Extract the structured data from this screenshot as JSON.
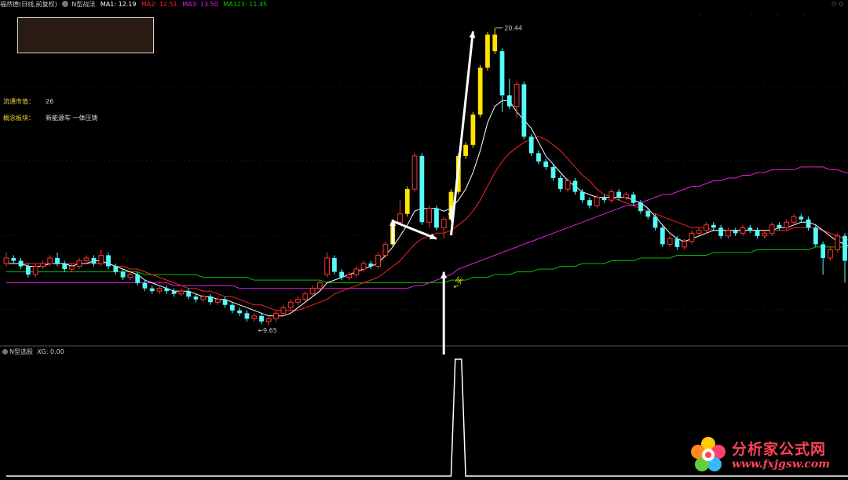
{
  "header": {
    "stock": "福然德(日线,前复权)",
    "indicator": "N型战法",
    "ma1": "MA1: 12.19",
    "ma2": "MA2: 12.51",
    "ma3": "MA3: 13.50",
    "ma123": "MA123: 11.45"
  },
  "colors": {
    "up": "#ff3232",
    "down": "#54fcfc",
    "signal": "#ffe400",
    "ma1": "#ffffff",
    "ma2": "#ff2020",
    "ma3": "#e020e0",
    "ma123": "#00c000"
  },
  "info": {
    "market_cap_label": "流通市值：",
    "market_cap_value": "26",
    "concept_label": "概念板块：",
    "concept_value": "新能源车 一体压铸"
  },
  "annotations": {
    "high": "20.44",
    "low": "9.65",
    "buy": "买"
  },
  "sub": {
    "name": "N型选股",
    "value": "XG: 0.00"
  },
  "watermark": {
    "title": "分析家公式网",
    "url": "www.fxjgsw.com"
  },
  "chart_data": {
    "type": "candlestick",
    "title": "福然德(日线,前复权)",
    "ylim": [
      9.0,
      21.0
    ],
    "candles": [
      [
        11.9,
        12.1,
        12.3,
        11.8
      ],
      [
        12.1,
        12.0,
        12.2,
        11.9
      ],
      [
        12.0,
        11.8,
        12.1,
        11.7
      ],
      [
        11.8,
        11.5,
        11.9,
        11.4
      ],
      [
        11.5,
        11.8,
        11.9,
        11.4
      ],
      [
        11.8,
        11.9,
        12.0,
        11.7
      ],
      [
        11.9,
        12.1,
        12.2,
        11.8
      ],
      [
        12.1,
        11.9,
        12.3,
        11.8
      ],
      [
        11.9,
        11.7,
        12.0,
        11.6
      ],
      [
        11.7,
        11.8,
        11.9,
        11.6
      ],
      [
        11.8,
        12.0,
        12.1,
        11.7
      ],
      [
        12.0,
        12.1,
        12.2,
        11.9
      ],
      [
        12.1,
        11.9,
        12.2,
        11.8
      ],
      [
        11.9,
        12.2,
        12.4,
        11.8
      ],
      [
        12.2,
        11.8,
        12.3,
        11.7
      ],
      [
        11.8,
        11.6,
        11.9,
        11.5
      ],
      [
        11.6,
        11.4,
        11.7,
        11.3
      ],
      [
        11.4,
        11.5,
        11.6,
        11.3
      ],
      [
        11.5,
        11.2,
        11.6,
        11.1
      ],
      [
        11.2,
        11.0,
        11.3,
        10.9
      ],
      [
        11.0,
        10.9,
        11.1,
        10.8
      ],
      [
        10.9,
        11.0,
        11.1,
        10.8
      ],
      [
        11.0,
        10.9,
        11.1,
        10.8
      ],
      [
        10.9,
        10.8,
        11.0,
        10.7
      ],
      [
        10.8,
        10.9,
        11.0,
        10.7
      ],
      [
        10.9,
        10.7,
        11.0,
        10.6
      ],
      [
        10.7,
        10.6,
        10.8,
        10.5
      ],
      [
        10.6,
        10.7,
        10.8,
        10.5
      ],
      [
        10.7,
        10.5,
        10.8,
        10.4
      ],
      [
        10.5,
        10.6,
        10.7,
        10.4
      ],
      [
        10.6,
        10.4,
        10.7,
        10.3
      ],
      [
        10.4,
        10.2,
        10.5,
        10.1
      ],
      [
        10.2,
        10.1,
        10.3,
        10.0
      ],
      [
        10.1,
        9.9,
        10.2,
        9.8
      ],
      [
        9.9,
        10.0,
        10.1,
        9.8
      ],
      [
        10.0,
        9.8,
        10.1,
        9.7
      ],
      [
        9.8,
        9.9,
        10.0,
        9.65
      ],
      [
        9.9,
        10.1,
        10.2,
        9.8
      ],
      [
        10.1,
        10.3,
        10.4,
        10.0
      ],
      [
        10.3,
        10.5,
        10.6,
        10.2
      ],
      [
        10.5,
        10.6,
        10.7,
        10.4
      ],
      [
        10.6,
        10.8,
        10.9,
        10.5
      ],
      [
        10.8,
        11.0,
        11.1,
        10.7
      ],
      [
        11.0,
        11.2,
        11.3,
        10.9
      ],
      [
        11.5,
        12.1,
        12.3,
        11.4
      ],
      [
        12.1,
        11.6,
        12.2,
        11.5
      ],
      [
        11.6,
        11.4,
        11.7,
        11.3
      ],
      [
        11.4,
        11.5,
        11.6,
        11.3
      ],
      [
        11.5,
        11.7,
        11.8,
        11.4
      ],
      [
        11.7,
        11.9,
        12.0,
        11.6
      ],
      [
        11.9,
        11.8,
        12.0,
        11.7
      ],
      [
        11.8,
        12.2,
        12.3,
        11.7
      ],
      [
        12.2,
        12.6,
        12.7,
        12.1
      ],
      [
        12.6,
        13.4,
        13.5,
        12.5
      ],
      [
        13.4,
        13.7,
        14.2,
        13.3
      ],
      [
        13.7,
        14.6,
        14.7,
        13.6
      ],
      [
        14.6,
        15.8,
        15.9,
        14.5
      ],
      [
        15.8,
        13.4,
        15.9,
        13.3
      ],
      [
        13.4,
        13.9,
        14.0,
        13.2
      ],
      [
        13.9,
        13.2,
        14.0,
        13.1
      ],
      [
        13.2,
        13.5,
        13.6,
        12.8
      ],
      [
        13.5,
        14.5,
        14.6,
        13.4
      ],
      [
        14.5,
        15.8,
        15.9,
        14.4
      ],
      [
        15.8,
        16.2,
        16.3,
        15.7
      ],
      [
        16.2,
        17.3,
        17.4,
        16.1
      ],
      [
        17.3,
        19.0,
        19.1,
        17.2
      ],
      [
        19.0,
        20.2,
        20.3,
        18.9
      ],
      [
        20.2,
        19.6,
        20.44,
        19.5
      ],
      [
        19.6,
        18.0,
        19.7,
        17.4
      ],
      [
        18.0,
        17.6,
        18.6,
        17.5
      ],
      [
        17.6,
        18.4,
        18.5,
        17.2
      ],
      [
        18.4,
        16.5,
        18.5,
        16.4
      ],
      [
        16.5,
        15.9,
        16.6,
        15.8
      ],
      [
        15.9,
        15.6,
        16.0,
        15.5
      ],
      [
        15.6,
        15.4,
        15.7,
        15.3
      ],
      [
        15.4,
        15.0,
        15.5,
        14.9
      ],
      [
        15.0,
        14.6,
        15.1,
        14.5
      ],
      [
        14.6,
        14.9,
        15.0,
        14.5
      ],
      [
        14.9,
        14.5,
        15.0,
        14.4
      ],
      [
        14.5,
        14.2,
        14.6,
        14.1
      ],
      [
        14.2,
        14.0,
        14.3,
        13.9
      ],
      [
        14.0,
        14.3,
        14.4,
        13.9
      ],
      [
        14.3,
        14.2,
        14.4,
        14.1
      ],
      [
        14.2,
        14.5,
        14.6,
        14.1
      ],
      [
        14.5,
        14.3,
        14.6,
        14.2
      ],
      [
        14.3,
        14.4,
        14.5,
        14.2
      ],
      [
        14.4,
        14.1,
        14.5,
        14.0
      ],
      [
        14.1,
        13.8,
        14.2,
        13.7
      ],
      [
        13.8,
        13.6,
        13.9,
        13.5
      ],
      [
        13.6,
        13.2,
        13.7,
        13.1
      ],
      [
        13.2,
        12.6,
        13.3,
        12.5
      ],
      [
        12.6,
        12.8,
        12.9,
        12.5
      ],
      [
        12.8,
        12.5,
        12.9,
        12.4
      ],
      [
        12.5,
        12.7,
        12.8,
        12.4
      ],
      [
        12.7,
        13.0,
        13.1,
        12.6
      ],
      [
        13.0,
        13.1,
        13.2,
        12.9
      ],
      [
        13.1,
        13.3,
        13.4,
        13.0
      ],
      [
        13.3,
        13.2,
        13.4,
        13.1
      ],
      [
        13.2,
        12.9,
        13.3,
        12.8
      ],
      [
        12.9,
        13.1,
        13.2,
        12.8
      ],
      [
        13.1,
        13.0,
        13.2,
        12.9
      ],
      [
        13.0,
        13.2,
        13.3,
        12.9
      ],
      [
        13.2,
        13.1,
        13.3,
        13.0
      ],
      [
        13.1,
        12.9,
        13.2,
        12.8
      ],
      [
        12.9,
        13.0,
        13.1,
        12.8
      ],
      [
        13.0,
        13.3,
        13.4,
        12.9
      ],
      [
        13.3,
        13.2,
        13.4,
        13.1
      ],
      [
        13.2,
        13.4,
        13.5,
        13.1
      ],
      [
        13.4,
        13.6,
        13.7,
        13.3
      ],
      [
        13.6,
        13.5,
        13.7,
        13.4
      ],
      [
        13.5,
        13.2,
        13.6,
        13.1
      ],
      [
        13.2,
        12.6,
        13.3,
        12.5
      ],
      [
        12.6,
        12.1,
        12.7,
        11.5
      ],
      [
        12.1,
        12.4,
        12.5,
        12.0
      ],
      [
        12.4,
        12.9,
        13.0,
        12.3
      ],
      [
        12.9,
        12.0,
        13.0,
        11.2
      ]
    ],
    "ma1": [
      11.9,
      11.9,
      11.9,
      11.8,
      11.8,
      11.8,
      11.9,
      11.9,
      11.9,
      11.8,
      11.9,
      11.9,
      12.0,
      12.0,
      11.9,
      11.8,
      11.7,
      11.6,
      11.5,
      11.3,
      11.2,
      11.1,
      11.0,
      10.9,
      10.9,
      10.9,
      10.8,
      10.7,
      10.7,
      10.6,
      10.6,
      10.5,
      10.4,
      10.3,
      10.2,
      10.1,
      10.0,
      10.0,
      10.0,
      10.1,
      10.3,
      10.5,
      10.7,
      10.9,
      11.2,
      11.3,
      11.4,
      11.5,
      11.6,
      11.7,
      11.8,
      11.9,
      12.2,
      12.5,
      12.9,
      13.3,
      13.8,
      13.9,
      13.9,
      13.9,
      13.8,
      13.9,
      14.2,
      14.6,
      15.2,
      16.0,
      17.0,
      17.6,
      17.8,
      17.8,
      17.4,
      17.1,
      16.8,
      16.3,
      15.8,
      15.5,
      15.2,
      14.9,
      14.7,
      14.5,
      14.4,
      14.3,
      14.3,
      14.3,
      14.3,
      14.3,
      14.2,
      14.1,
      13.9,
      13.6,
      13.3,
      13.0,
      12.8,
      12.7,
      12.8,
      12.9,
      13.0,
      13.1,
      13.1,
      13.1,
      13.1,
      13.1,
      13.1,
      13.1,
      13.1,
      13.1,
      13.2,
      13.2,
      13.3,
      13.4,
      13.4,
      13.3,
      13.1,
      12.9,
      12.7,
      12.6,
      12.5
    ],
    "ma2": [
      11.9,
      11.9,
      11.9,
      11.9,
      11.9,
      11.9,
      11.9,
      11.9,
      11.9,
      11.9,
      11.9,
      11.9,
      11.9,
      11.9,
      11.9,
      11.8,
      11.8,
      11.7,
      11.7,
      11.6,
      11.5,
      11.4,
      11.3,
      11.2,
      11.1,
      11.0,
      11.0,
      10.9,
      10.9,
      10.8,
      10.7,
      10.7,
      10.6,
      10.5,
      10.4,
      10.4,
      10.3,
      10.2,
      10.2,
      10.2,
      10.2,
      10.3,
      10.4,
      10.5,
      10.6,
      10.8,
      10.9,
      11.0,
      11.1,
      11.2,
      11.3,
      11.4,
      11.6,
      11.8,
      12.0,
      12.3,
      12.6,
      12.8,
      12.9,
      13.0,
      13.0,
      13.1,
      13.3,
      13.5,
      13.8,
      14.2,
      14.7,
      15.2,
      15.6,
      15.9,
      16.1,
      16.3,
      16.4,
      16.5,
      16.4,
      16.2,
      16.0,
      15.7,
      15.4,
      15.1,
      14.9,
      14.6,
      14.4,
      14.3,
      14.2,
      14.1,
      14.0,
      13.9,
      13.8,
      13.7,
      13.6,
      13.5,
      13.4,
      13.3,
      13.2,
      13.2,
      13.2,
      13.1,
      13.1,
      13.1,
      13.1,
      13.1,
      13.1,
      13.1,
      13.1,
      13.1,
      13.1,
      13.1,
      13.2,
      13.2,
      13.2,
      13.2,
      13.1,
      13.0,
      12.9,
      12.8,
      12.7
    ],
    "ma3": [
      11.2,
      11.2,
      11.2,
      11.2,
      11.2,
      11.2,
      11.2,
      11.2,
      11.2,
      11.2,
      11.2,
      11.2,
      11.2,
      11.2,
      11.2,
      11.2,
      11.2,
      11.2,
      11.2,
      11.2,
      11.2,
      11.2,
      11.2,
      11.1,
      11.1,
      11.1,
      11.1,
      11.1,
      11.1,
      11.1,
      11.1,
      11.1,
      11.0,
      11.0,
      11.0,
      11.0,
      11.0,
      11.0,
      11.0,
      11.0,
      11.0,
      11.0,
      11.0,
      11.0,
      11.0,
      11.0,
      11.0,
      11.0,
      11.0,
      11.0,
      11.0,
      11.0,
      11.0,
      11.0,
      11.0,
      11.0,
      11.1,
      11.1,
      11.2,
      11.3,
      11.4,
      11.5,
      11.7,
      11.8,
      11.9,
      12.0,
      12.1,
      12.2,
      12.3,
      12.4,
      12.5,
      12.6,
      12.7,
      12.8,
      12.9,
      13.0,
      13.1,
      13.2,
      13.3,
      13.4,
      13.5,
      13.6,
      13.7,
      13.8,
      13.9,
      14.0,
      14.0,
      14.1,
      14.2,
      14.3,
      14.4,
      14.4,
      14.5,
      14.6,
      14.7,
      14.7,
      14.8,
      14.9,
      14.9,
      15.0,
      15.0,
      15.1,
      15.1,
      15.2,
      15.2,
      15.3,
      15.3,
      15.3,
      15.3,
      15.4,
      15.4,
      15.4,
      15.4,
      15.3,
      15.3,
      15.2,
      15.2
    ],
    "ma123": [
      11.6,
      11.6,
      11.6,
      11.6,
      11.6,
      11.6,
      11.6,
      11.6,
      11.6,
      11.6,
      11.6,
      11.6,
      11.6,
      11.6,
      11.6,
      11.6,
      11.6,
      11.6,
      11.6,
      11.5,
      11.5,
      11.5,
      11.5,
      11.5,
      11.5,
      11.5,
      11.5,
      11.4,
      11.4,
      11.4,
      11.4,
      11.4,
      11.4,
      11.4,
      11.3,
      11.3,
      11.3,
      11.3,
      11.3,
      11.3,
      11.3,
      11.3,
      11.3,
      11.3,
      11.2,
      11.2,
      11.2,
      11.2,
      11.2,
      11.2,
      11.2,
      11.2,
      11.2,
      11.2,
      11.2,
      11.2,
      11.2,
      11.2,
      11.2,
      11.2,
      11.2,
      11.3,
      11.3,
      11.3,
      11.4,
      11.4,
      11.4,
      11.5,
      11.5,
      11.5,
      11.6,
      11.6,
      11.6,
      11.7,
      11.7,
      11.7,
      11.8,
      11.8,
      11.8,
      11.9,
      11.9,
      11.9,
      11.9,
      12.0,
      12.0,
      12.0,
      12.0,
      12.1,
      12.1,
      12.1,
      12.1,
      12.1,
      12.2,
      12.2,
      12.2,
      12.2,
      12.2,
      12.3,
      12.3,
      12.3,
      12.3,
      12.3,
      12.3,
      12.4,
      12.4,
      12.4,
      12.4,
      12.4,
      12.4,
      12.4,
      12.4,
      12.5,
      12.5,
      12.5,
      12.5,
      12.5,
      12.5
    ],
    "signal_candles": [
      53,
      55,
      61,
      62,
      63,
      64,
      65,
      66,
      67
    ],
    "xg": [
      0,
      0,
      0,
      0,
      0,
      0,
      0,
      0,
      0,
      0,
      0,
      0,
      0,
      0,
      0,
      0,
      0,
      0,
      0,
      0,
      0,
      0,
      0,
      0,
      0,
      0,
      0,
      0,
      0,
      0,
      0,
      0,
      0,
      0,
      0,
      0,
      0,
      0,
      0,
      0,
      0,
      0,
      0,
      0,
      0,
      0,
      0,
      0,
      0,
      0,
      0,
      0,
      0,
      0,
      0,
      0,
      0,
      0,
      0,
      0,
      0,
      0,
      1,
      0,
      0,
      0,
      0,
      0,
      0,
      0,
      0,
      0,
      0,
      0,
      0,
      0,
      0,
      0,
      0,
      0,
      0,
      0,
      0,
      0,
      0,
      0,
      0,
      0,
      0,
      0,
      0,
      0,
      0,
      0,
      0,
      0,
      0,
      0,
      0,
      0,
      0,
      0,
      0,
      0,
      0,
      0,
      0,
      0,
      0,
      0,
      0,
      0,
      0,
      0,
      0,
      0,
      0,
      0,
      0
    ]
  }
}
